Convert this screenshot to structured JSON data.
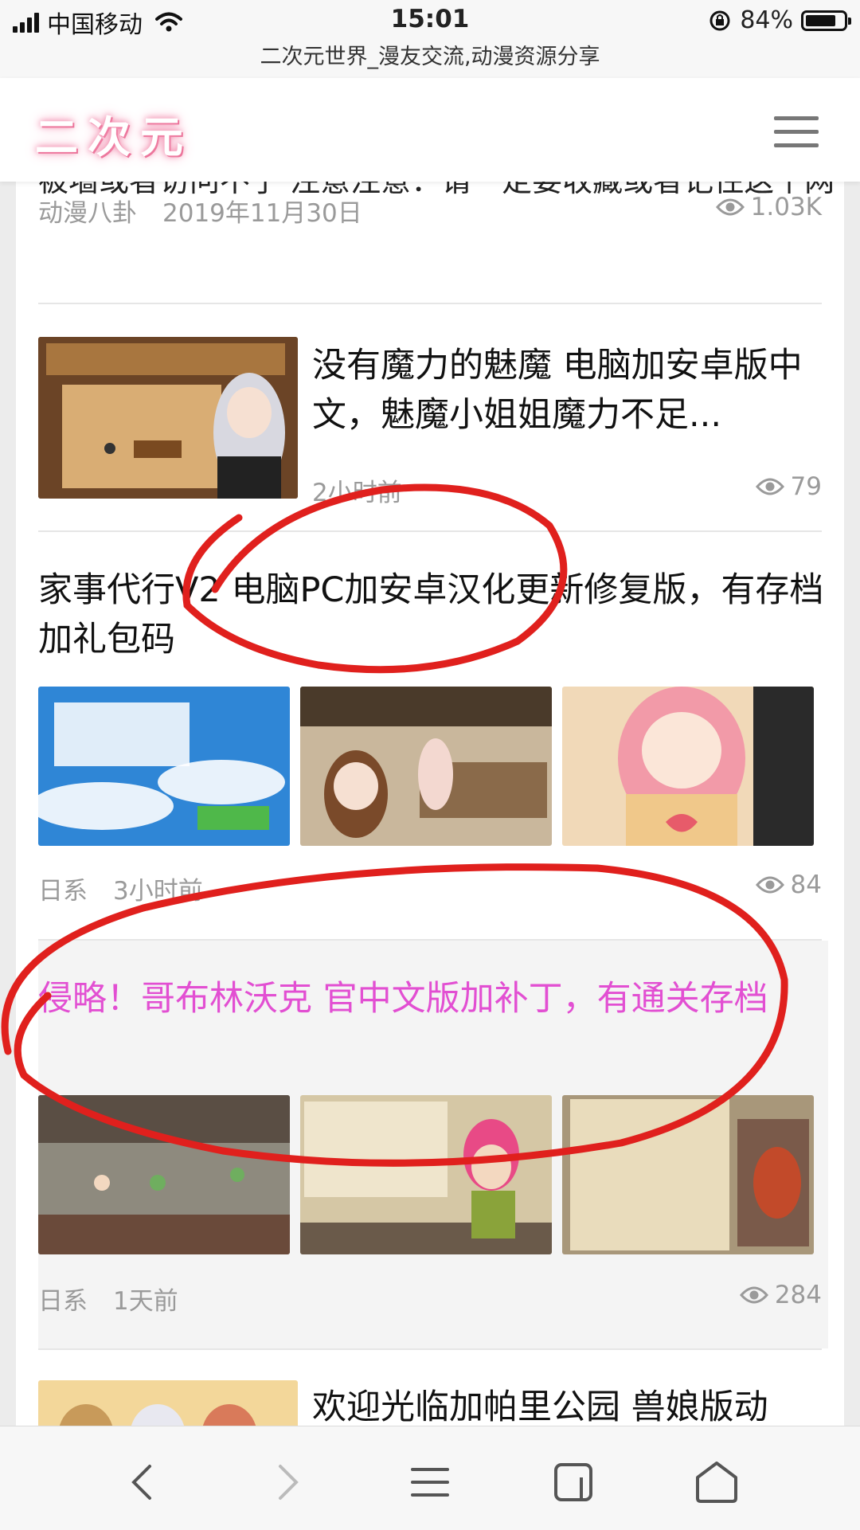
{
  "status_bar": {
    "carrier": "中国移动",
    "time": "15:01",
    "battery": "84%",
    "battery_level": 0.84
  },
  "browser": {
    "page_title": "二次元世界_漫友交流,动漫资源分享"
  },
  "site": {
    "logo": "二次元"
  },
  "top_fragment": {
    "text": "被墙或者访问不了 注意注意：请一定要收藏或者记住这个网",
    "category": "动漫八卦",
    "date": "2019年11月30日",
    "views": "1.03K"
  },
  "articles": [
    {
      "title": "没有魔力的魅魔 电脑加安卓版中文，魅魔小姐姐魔力不足...",
      "time": "2小时前",
      "views": "79"
    },
    {
      "title": "家事代行V2 电脑PC加安卓汉化更新修复版，有存档加礼包码",
      "category": "日系",
      "time": "3小时前",
      "views": "84"
    },
    {
      "title": "侵略！哥布林沃克 官中文版加补丁，有通关存档",
      "category": "日系",
      "time": "1天前",
      "views": "284"
    },
    {
      "title": "欢迎光临加帕里公园 兽娘版动"
    }
  ],
  "colors": {
    "highlight_title": "#e24fd2",
    "annotation": "#e0201d",
    "meta": "#9a9a9a"
  },
  "icons": {
    "eye": "eye-icon",
    "back": "chevron-left-icon",
    "forward": "chevron-right-icon",
    "menu": "hamburger-menu-icon",
    "tabs": "tabs-icon",
    "home": "home-icon"
  }
}
